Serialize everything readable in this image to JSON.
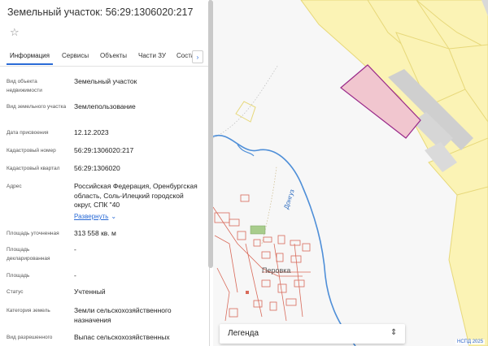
{
  "panel": {
    "title": "Земельный участок: 56:29:1306020:217",
    "star_icon": "star-outline-icon",
    "tabs": [
      {
        "label": "Информация",
        "active": true
      },
      {
        "label": "Сервисы",
        "active": false
      },
      {
        "label": "Объекты",
        "active": false
      },
      {
        "label": "Части ЗУ",
        "active": false
      },
      {
        "label": "Соста",
        "active": false
      }
    ],
    "tab_next_icon": "chevron-right-icon",
    "rows": [
      {
        "label": "Вид объекта недвижимости",
        "value": "Земельный участок"
      },
      {
        "label": "Вид земельного участка",
        "value": "Землепользование"
      },
      {
        "label": "Дата присвоения",
        "value": "12.12.2023"
      },
      {
        "label": "Кадастровый номер",
        "value": "56:29:1306020:217"
      },
      {
        "label": "Кадастровый квартал",
        "value": "56:29:1306020"
      },
      {
        "label": "Адрес",
        "value": "Российская Федерация, Оренбургская область, Соль-Илецкий городской округ, СПК \"40"
      },
      {
        "label": "Площадь уточненная",
        "value": "313 558 кв. м"
      },
      {
        "label": "Площадь декларированная",
        "value": "-"
      },
      {
        "label": "Площадь",
        "value": "-"
      },
      {
        "label": "Статус",
        "value": "Учтенный"
      },
      {
        "label": "Категория земель",
        "value": "Земли сельскохозяйственного назначения"
      },
      {
        "label": "Вид разрешенного",
        "value": "Выпас сельскохозяйственных"
      }
    ],
    "expand_label": "Развернуть"
  },
  "map": {
    "river_label": "Донгуз",
    "village_label": "Перовка",
    "legend_label": "Легенда",
    "legend_icon": "updown-chevron-icon",
    "attribution": "НСПД 2025",
    "colors": {
      "parcel_yellow": "#fbf3b5",
      "parcel_border": "#e7d87a",
      "selected_fill": "#f1c6cf",
      "selected_border": "#9a2a8a",
      "river": "#4f8fd8",
      "road_gray": "#c8c8c8",
      "building_red": "#d86a5a"
    }
  }
}
